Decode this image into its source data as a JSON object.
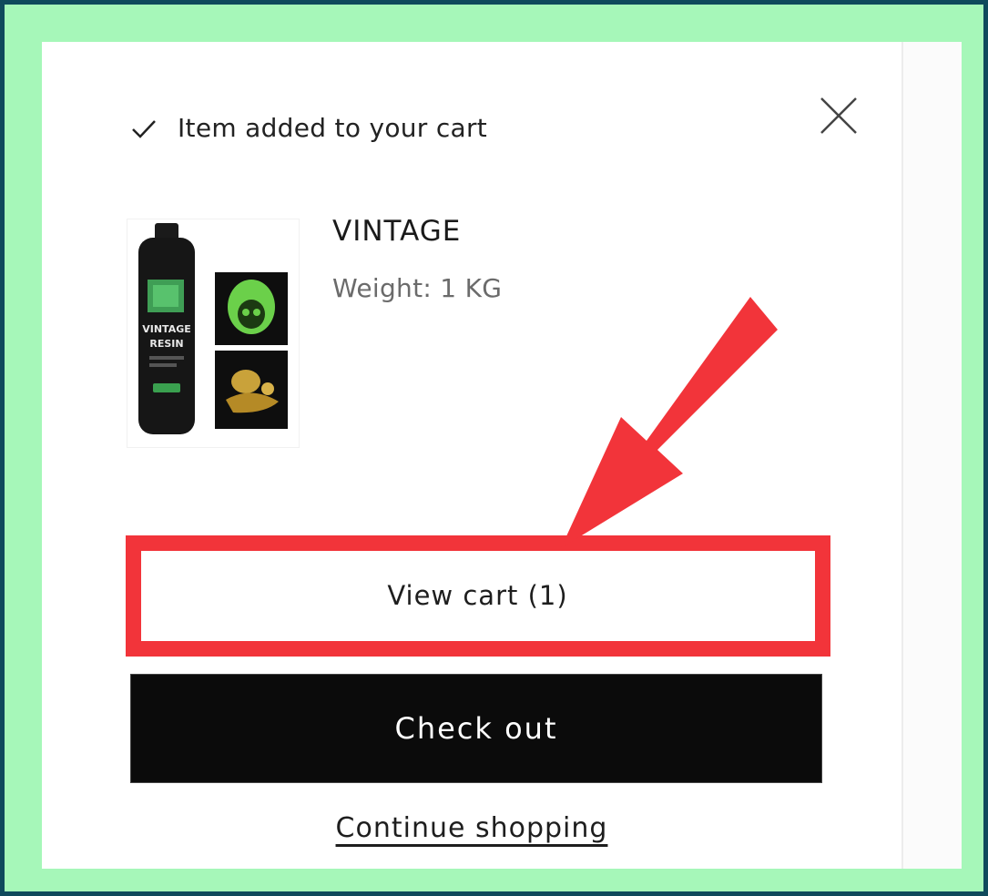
{
  "notification": {
    "added_text": "Item added to your cart",
    "close_label": "Close"
  },
  "product": {
    "name": "VINTAGE",
    "weight": "Weight: 1 KG",
    "image_label_line1": "VINTAGE",
    "image_label_line2": "RESIN"
  },
  "actions": {
    "view_cart": "View cart (1)",
    "checkout": "Check out",
    "continue": "Continue shopping"
  },
  "colors": {
    "highlight": "#f2343a",
    "checkout_bg": "#0b0b0b",
    "frame": "#a6f7b9",
    "background": "#0f4a5c"
  },
  "icons": {
    "check": "check-icon",
    "close": "close-icon",
    "arrow": "arrow-annotation"
  }
}
